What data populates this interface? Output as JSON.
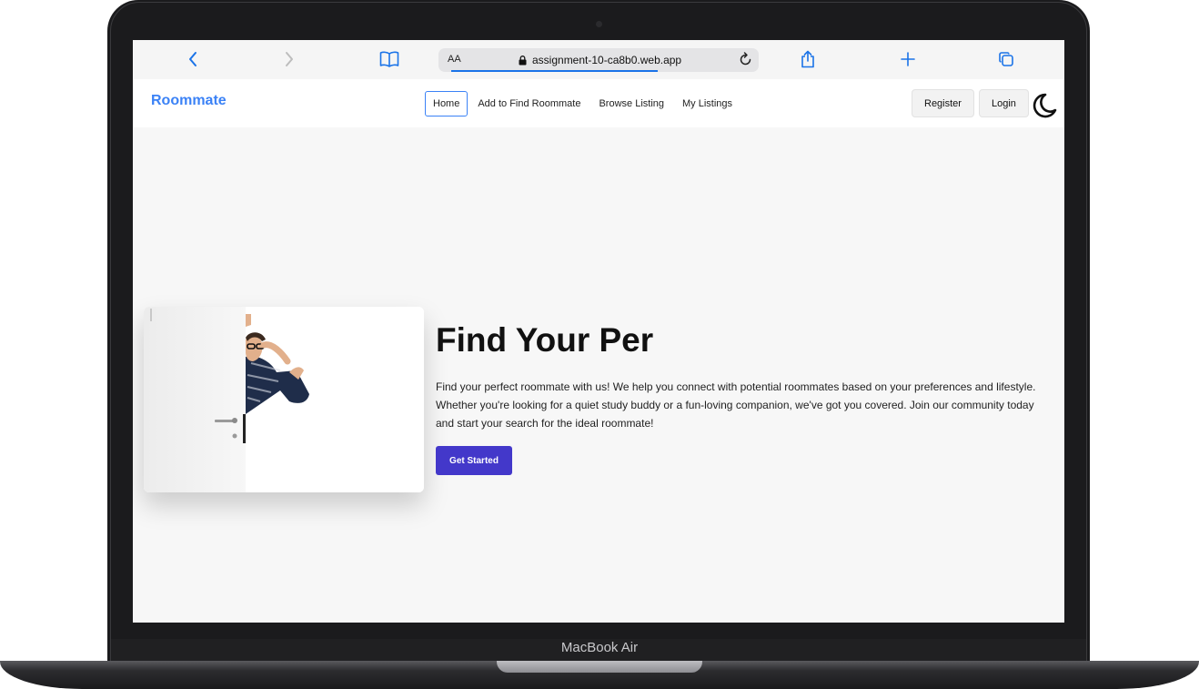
{
  "device": {
    "label": "MacBook Air"
  },
  "browser": {
    "text_size_label": "AA",
    "url": "assignment-10-ca8b0.web.app",
    "load_progress": 0.7
  },
  "site": {
    "brand": "Roommate",
    "nav": [
      {
        "label": "Home",
        "active": true
      },
      {
        "label": "Add to Find Roommate",
        "active": false
      },
      {
        "label": "Browse Listing",
        "active": false
      },
      {
        "label": "My Listings",
        "active": false
      }
    ],
    "register_label": "Register",
    "login_label": "Login",
    "theme_icon": "moon-icon"
  },
  "hero": {
    "title": "Find Your Per",
    "description": "Find your perfect roommate with us! We help you connect with potential roommates based on your preferences and lifestyle. Whether you're looking for a quiet study buddy or a fun-loving companion, we've got you covered. Join our community today and start your search for the ideal roommate!",
    "cta_label": "Get Started",
    "image_subject": "man peeking from behind a white door"
  },
  "colors": {
    "brand": "#3b82f6",
    "cta": "#4338ca",
    "browser_accent": "#1a73e8"
  }
}
